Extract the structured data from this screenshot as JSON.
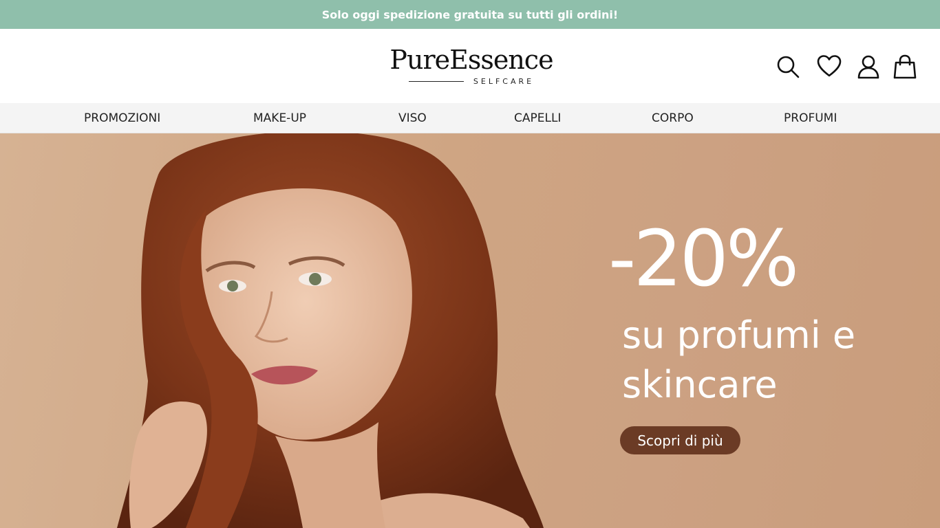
{
  "announcement": "Solo oggi spedizione gratuita su tutti gli ordini!",
  "brand": {
    "name": "PureEssence",
    "tagline": "SELFCARE"
  },
  "header_icons": [
    "search-icon",
    "heart-icon",
    "user-icon",
    "shopping-bag-icon"
  ],
  "nav": {
    "items": [
      "PROMOZIONI",
      "MAKE-UP",
      "VISO",
      "CAPELLI",
      "CORPO",
      "PROFUMI"
    ]
  },
  "hero": {
    "discount": "-20%",
    "line1": "su profumi e",
    "line2": "skincare",
    "cta_label": "Scopri di più"
  },
  "colors": {
    "announcement_bg": "#8fbfab",
    "hero_bg": "#cfa583",
    "cta_bg": "#6b3b25",
    "text_dark": "#111111"
  }
}
